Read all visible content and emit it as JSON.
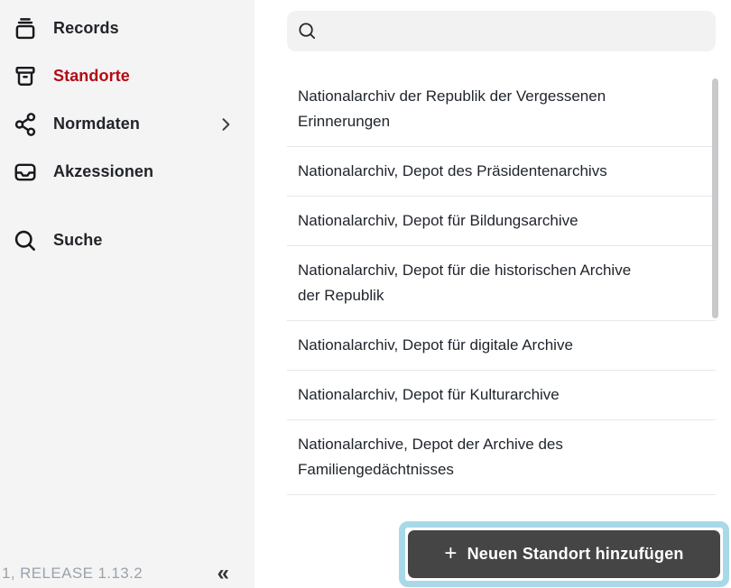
{
  "colors": {
    "accent_red": "#b30b15",
    "sidebar_bg": "#f4f4f5",
    "button_bg": "#454545",
    "highlight_blue": "#a9d9e8",
    "divider": "#e5e7ec",
    "footer_text_gray": "#9aa2ad",
    "search_bg": "#f2f2f3"
  },
  "sidebar": {
    "items": [
      {
        "label": "Records",
        "icon": "records-icon",
        "active": false,
        "chevron": false
      },
      {
        "label": "Standorte",
        "icon": "archive-box-icon",
        "active": true,
        "chevron": false
      },
      {
        "label": "Normdaten",
        "icon": "share-icon",
        "active": false,
        "chevron": true
      },
      {
        "label": "Akzessionen",
        "icon": "inbox-icon",
        "active": false,
        "chevron": false
      },
      {
        "label": "Suche",
        "icon": "search-icon",
        "active": false,
        "chevron": false
      }
    ],
    "footer": {
      "version": "1, RELEASE 1.13.2",
      "collapse_glyph": "«"
    }
  },
  "main": {
    "search": {
      "value": "",
      "placeholder": ""
    },
    "list": {
      "items": [
        {
          "lines": [
            "Nationalarchiv der Republik der Vergessenen",
            "Erinnerungen"
          ]
        },
        {
          "lines": [
            "Nationalarchiv, Depot des Präsidentenarchivs"
          ]
        },
        {
          "lines": [
            "Nationalarchiv, Depot für Bildungsarchive"
          ]
        },
        {
          "lines": [
            "Nationalarchiv, Depot für die historischen Archive",
            "der Republik"
          ]
        },
        {
          "lines": [
            "Nationalarchiv, Depot für digitale Archive"
          ]
        },
        {
          "lines": [
            "Nationalarchiv, Depot für Kulturarchive"
          ]
        },
        {
          "lines": [
            "Nationalarchive, Depot der Archive des",
            "Familiengedächtnisses"
          ]
        }
      ]
    },
    "add_button": {
      "plus": "+",
      "label": "Neuen Standort hinzufügen"
    }
  }
}
